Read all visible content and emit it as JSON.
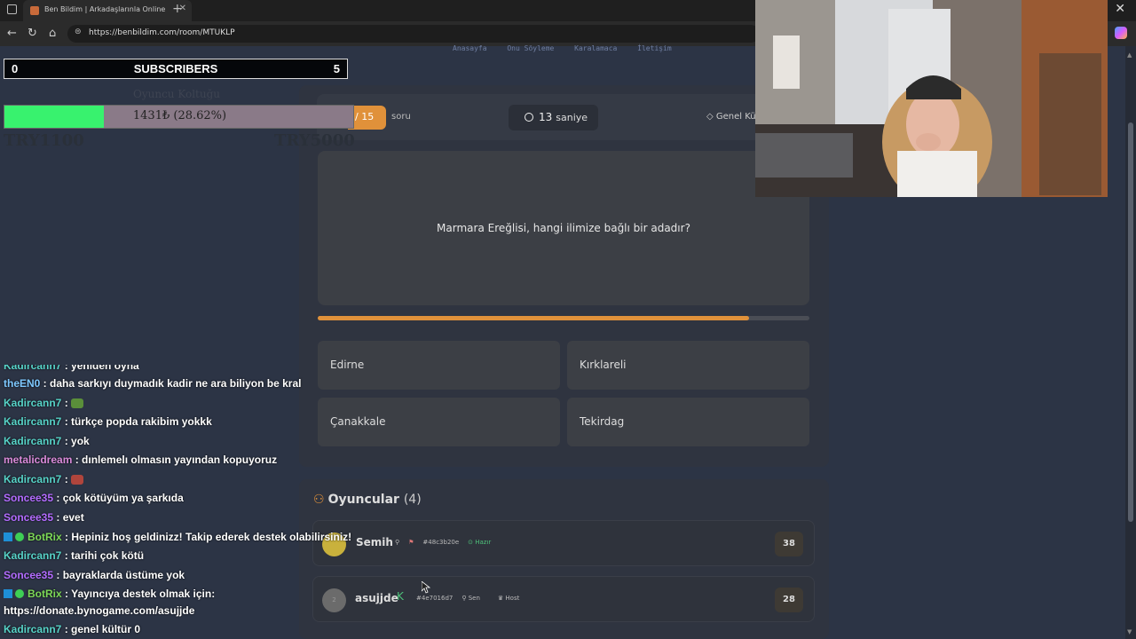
{
  "browser": {
    "tab_title": "Ben Bildim | Arkadaşlarınla Online",
    "url": "https://benbildim.com/room/MTUKLP"
  },
  "nav": [
    "Anasayfa",
    "Onu Söyleme",
    "Karalamaca",
    "İletişim"
  ],
  "quiz": {
    "question_badge": "/ 15",
    "question_word": "soru",
    "timer_value": "13",
    "timer_unit": "saniye",
    "category": "Genel Kül",
    "question": "Marmara Ereğlisi, hangi ilimize bağlı bir adadır?",
    "progress_fraction": 0.877,
    "answers": [
      "Edirne",
      "Kırklareli",
      "Çanakkale",
      "Tekirdag"
    ]
  },
  "players": {
    "title": "Oyuncular",
    "count": "(4)",
    "list": [
      {
        "name": "Semih",
        "id": "#48c3b20e",
        "status": "Hazır",
        "score": "38",
        "avatar_color": "#c9b13c",
        "avatar_text": ""
      },
      {
        "name": "asujjde",
        "id": "#4e7016d7",
        "tag1": "Sen",
        "tag2": "Host",
        "score": "28",
        "avatar_color": "#6b6b6b",
        "avatar_text": "2"
      }
    ]
  },
  "overlay": {
    "subs_left": "0",
    "subs_label": "SUBSCRIBERS",
    "subs_right": "5",
    "goal_title": "Oyuncu Koltuğu",
    "goal_text": "1431₺ (28.62%)",
    "goal_fraction": 0.2862,
    "goal_min": "TRY1100",
    "goal_max": "TRY5000"
  },
  "chat": [
    {
      "user": "Kadircann7",
      "text": " : yeniden oyna",
      "color": "#57d3c8"
    },
    {
      "user": "theEN0",
      "text": " : daha sarkıyı duymadık kadir ne ara biliyon be kral",
      "color": "#7ec8ff"
    },
    {
      "user": "Kadircann7",
      "text": " : ",
      "color": "#57d3c8",
      "emote": "#5a8f3a"
    },
    {
      "user": "Kadircann7",
      "text": " : türkçe popda rakibim yokkk",
      "color": "#57d3c8"
    },
    {
      "user": "Kadircann7",
      "text": " : yok",
      "color": "#57d3c8"
    },
    {
      "user": "metalicdream",
      "text": " : dınlemelı olmasın yayından kopuyoruz",
      "color": "#d98ad9"
    },
    {
      "user": "Kadircann7",
      "text": " : ",
      "color": "#57d3c8",
      "emote": "#b0453c"
    },
    {
      "user": "Soncee35",
      "text": " : çok kötüyüm ya şarkıda",
      "color": "#b36cff"
    },
    {
      "user": "Soncee35",
      "text": " : evet",
      "color": "#b36cff"
    },
    {
      "user": "BotRix",
      "text": " : Hepiniz hoş geldinizz! Takip ederek destek olabilirsiniz!",
      "color": "#7dd957",
      "bot": true
    },
    {
      "user": "Kadircann7",
      "text": " : tarihi çok kötü",
      "color": "#57d3c8"
    },
    {
      "user": "Soncee35",
      "text": " : bayraklarda üstüme yok",
      "color": "#b36cff"
    },
    {
      "user": "BotRix",
      "text": " : Yayıncıya destek olmak için:",
      "color": "#7dd957",
      "bot": true
    },
    {
      "user": "",
      "text": "https://donate.bynogame.com/asujjde",
      "color": "#fff"
    },
    {
      "user": "Kadircann7",
      "text": " : genel kültür 0",
      "color": "#57d3c8"
    }
  ]
}
